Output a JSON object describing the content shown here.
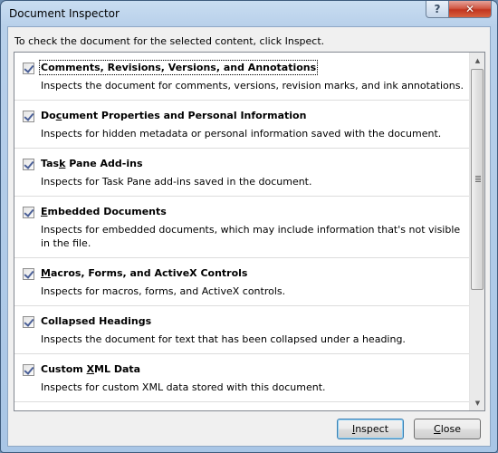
{
  "window": {
    "title": "Document Inspector",
    "help_button": "?",
    "close_button": "✕"
  },
  "instruction": "To check the document for the selected content, click Inspect.",
  "items": [
    {
      "label_pre": "",
      "label_u": "",
      "label_post": "Comments, Revisions, Versions, and Annotations",
      "checked": true,
      "description": "Inspects the document for comments, versions, revision marks, and ink annotations."
    },
    {
      "label_pre": "Do",
      "label_u": "c",
      "label_post": "ument Properties and Personal Information",
      "checked": true,
      "description": "Inspects for hidden metadata or personal information saved with the document."
    },
    {
      "label_pre": "Tas",
      "label_u": "k",
      "label_post": " Pane Add-ins",
      "checked": true,
      "description": "Inspects for Task Pane add-ins saved in the document."
    },
    {
      "label_pre": "",
      "label_u": "E",
      "label_post": "mbedded Documents",
      "checked": true,
      "description": "Inspects for embedded documents, which may include information that's not visible in the file."
    },
    {
      "label_pre": "",
      "label_u": "M",
      "label_post": "acros, Forms, and ActiveX Controls",
      "checked": true,
      "description": "Inspects for macros, forms, and ActiveX controls."
    },
    {
      "label_pre": "",
      "label_u": "",
      "label_post": "Collapsed Headings",
      "checked": true,
      "description": "Inspects the document for text that has been collapsed under a heading."
    },
    {
      "label_pre": "Custom ",
      "label_u": "X",
      "label_post": "ML Data",
      "checked": true,
      "description": "Inspects for custom XML data stored with this document."
    }
  ],
  "scrollbar": {
    "up_arrow": "▲",
    "down_arrow": "▼",
    "scroll_position_percent": 0
  },
  "buttons": {
    "inspect": {
      "pre": "",
      "u": "I",
      "post": "nspect"
    },
    "close": {
      "pre": "",
      "u": "C",
      "post": "lose"
    }
  }
}
